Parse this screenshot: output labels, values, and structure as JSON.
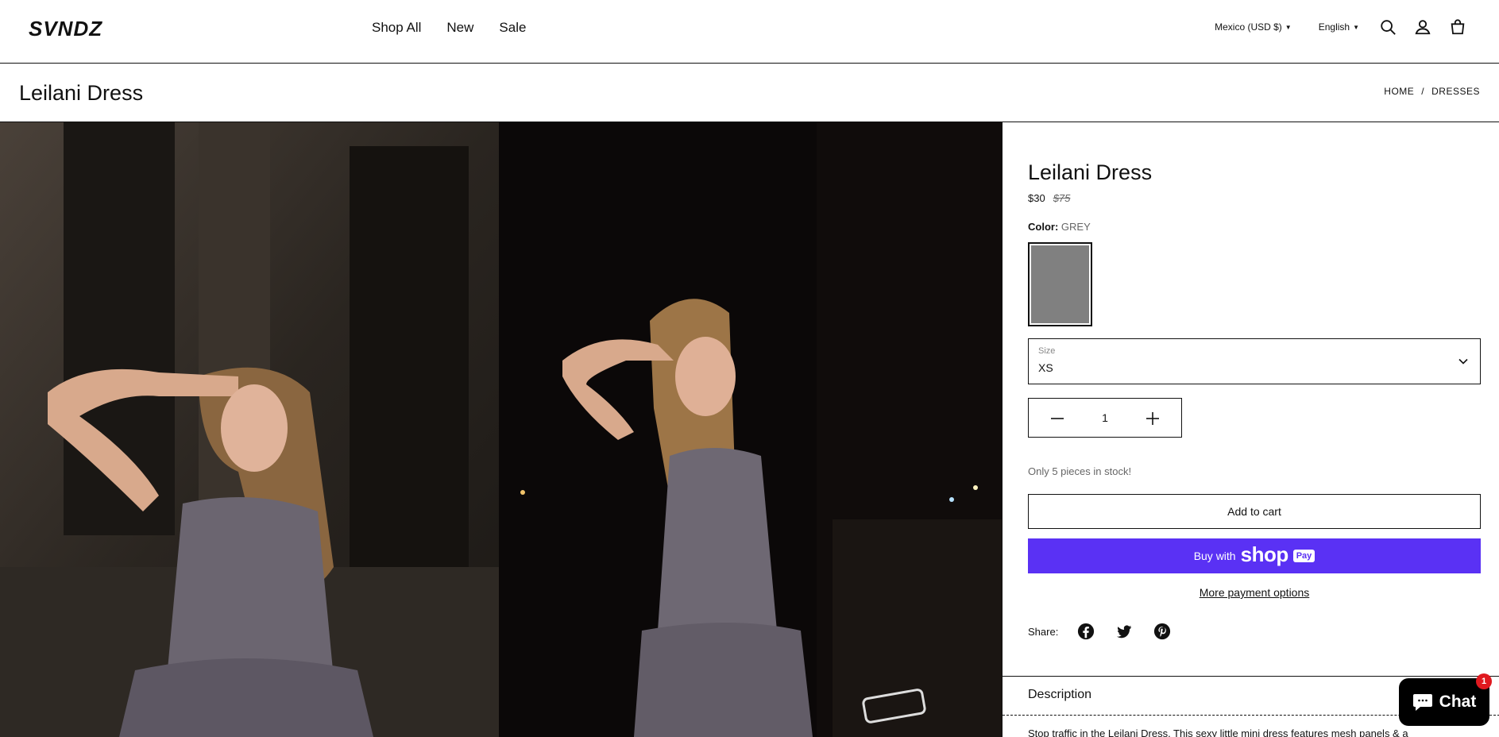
{
  "brand": {
    "logo_text": "SVNDZ"
  },
  "nav": {
    "items": [
      "Shop All",
      "New",
      "Sale"
    ]
  },
  "header": {
    "currency": "Mexico (USD $)",
    "language": "English",
    "icons": [
      "search-icon",
      "account-icon",
      "cart-icon"
    ]
  },
  "page": {
    "title": "Leilani Dress",
    "breadcrumb": [
      "HOME",
      "/",
      "DRESSES"
    ]
  },
  "product": {
    "title": "Leilani Dress",
    "price": "$30",
    "compare_price": "$75",
    "color_label": "Color:",
    "color_value": "GREY",
    "swatch_color": "#808080",
    "size_label": "Size",
    "size_value": "XS",
    "quantity": "1",
    "stock_text": "Only 5 pieces in stock!",
    "add_to_cart": "Add to cart",
    "buy_with": "Buy with",
    "shop_brand": "shop",
    "pay_badge": "Pay",
    "more_payment": "More payment options",
    "share_label": "Share:",
    "share_icons": [
      "facebook-icon",
      "twitter-icon",
      "pinterest-icon"
    ],
    "description_title": "Description",
    "description_text": "Stop traffic in the Leilani Dress. This sexy little mini dress features mesh panels & a"
  },
  "chat": {
    "label": "Chat",
    "badge": "1"
  },
  "colors": {
    "shop_pay": "#5a31f4",
    "badge": "#e0191f"
  }
}
